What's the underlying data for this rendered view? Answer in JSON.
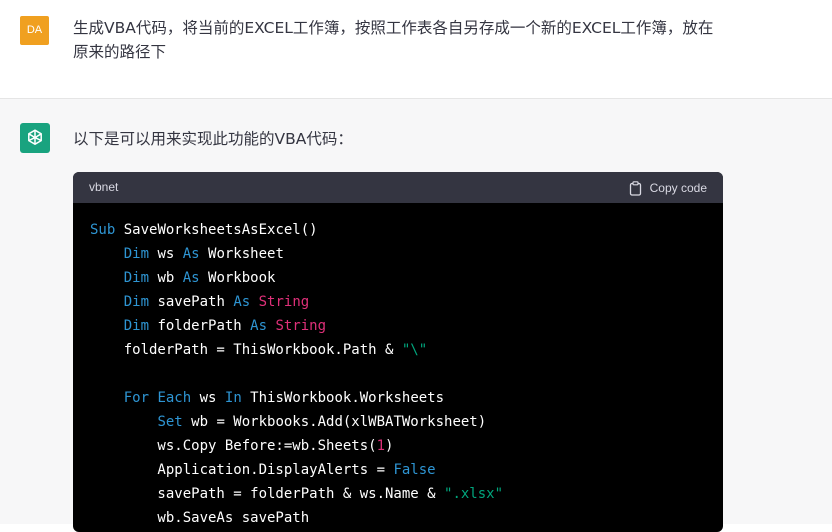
{
  "user_message": {
    "avatar_initials": "DA",
    "text": "生成VBA代码，将当前的EXCEL工作簿，按照工作表各自另存成一个新的EXCEL工作簿，放在原来的路径下"
  },
  "assistant_message": {
    "avatar_icon": "openai-logo-icon",
    "intro_text": "以下是可以用来实现此功能的VBA代码：",
    "code_block": {
      "language": "vbnet",
      "copy_label": "Copy code",
      "copy_icon": "clipboard-icon",
      "lines": [
        [
          {
            "t": "kw",
            "v": "Sub"
          },
          {
            "t": "txt",
            "v": " SaveWorksheetsAsExcel()"
          }
        ],
        [
          {
            "t": "txt",
            "v": "    "
          },
          {
            "t": "kw",
            "v": "Dim"
          },
          {
            "t": "txt",
            "v": " ws "
          },
          {
            "t": "kw",
            "v": "As"
          },
          {
            "t": "txt",
            "v": " Worksheet"
          }
        ],
        [
          {
            "t": "txt",
            "v": "    "
          },
          {
            "t": "kw",
            "v": "Dim"
          },
          {
            "t": "txt",
            "v": " wb "
          },
          {
            "t": "kw",
            "v": "As"
          },
          {
            "t": "txt",
            "v": " Workbook"
          }
        ],
        [
          {
            "t": "txt",
            "v": "    "
          },
          {
            "t": "kw",
            "v": "Dim"
          },
          {
            "t": "txt",
            "v": " savePath "
          },
          {
            "t": "kw",
            "v": "As"
          },
          {
            "t": "txt",
            "v": " "
          },
          {
            "t": "ty",
            "v": "String"
          }
        ],
        [
          {
            "t": "txt",
            "v": "    "
          },
          {
            "t": "kw",
            "v": "Dim"
          },
          {
            "t": "txt",
            "v": " folderPath "
          },
          {
            "t": "kw",
            "v": "As"
          },
          {
            "t": "txt",
            "v": " "
          },
          {
            "t": "ty",
            "v": "String"
          }
        ],
        [
          {
            "t": "txt",
            "v": "    folderPath = ThisWorkbook.Path & "
          },
          {
            "t": "str",
            "v": "\"\\\""
          }
        ],
        [],
        [
          {
            "t": "txt",
            "v": "    "
          },
          {
            "t": "kw",
            "v": "For"
          },
          {
            "t": "txt",
            "v": " "
          },
          {
            "t": "kw",
            "v": "Each"
          },
          {
            "t": "txt",
            "v": " ws "
          },
          {
            "t": "kw",
            "v": "In"
          },
          {
            "t": "txt",
            "v": " ThisWorkbook.Worksheets"
          }
        ],
        [
          {
            "t": "txt",
            "v": "        "
          },
          {
            "t": "kw",
            "v": "Set"
          },
          {
            "t": "txt",
            "v": " wb = Workbooks.Add(xlWBATWorksheet)"
          }
        ],
        [
          {
            "t": "txt",
            "v": "        ws.Copy Before:=wb.Sheets("
          },
          {
            "t": "num",
            "v": "1"
          },
          {
            "t": "txt",
            "v": ")"
          }
        ],
        [
          {
            "t": "txt",
            "v": "        Application.DisplayAlerts = "
          },
          {
            "t": "kw",
            "v": "False"
          }
        ],
        [
          {
            "t": "txt",
            "v": "        savePath = folderPath & ws.Name & "
          },
          {
            "t": "str",
            "v": "\".xlsx\""
          }
        ],
        [
          {
            "t": "txt",
            "v": "        wb.SaveAs savePath"
          }
        ]
      ]
    }
  },
  "colors": {
    "user_avatar_bg": "#f0a020",
    "bot_avatar_bg": "#19a37f",
    "code_header_bg": "#343541",
    "code_bg": "#000000",
    "keyword": "#2e95d3",
    "type": "#df3079",
    "string": "#00a67d"
  }
}
